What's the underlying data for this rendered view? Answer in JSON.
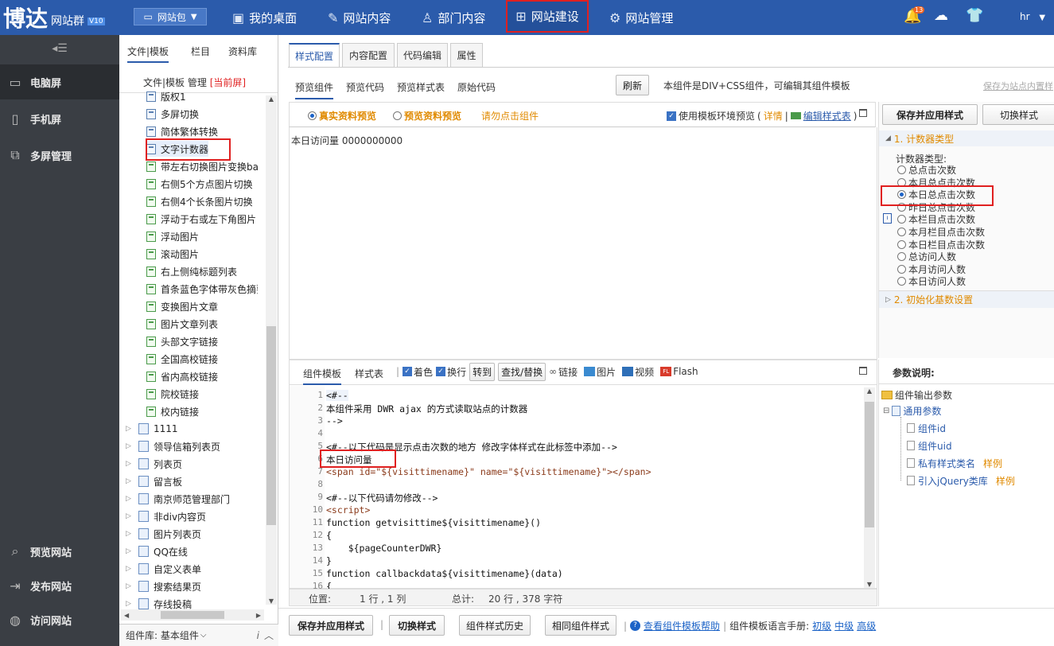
{
  "brand": {
    "name": "博达",
    "product": "网站群",
    "version": "V10",
    "accent": "#2b5bab"
  },
  "topbar": {
    "site_selector": "网站包",
    "nav": [
      {
        "label": "我的桌面",
        "icon": "monitor-icon"
      },
      {
        "label": "网站内容",
        "icon": "edit-icon"
      },
      {
        "label": "部门内容",
        "icon": "org-icon"
      },
      {
        "label": "网站建设",
        "icon": "build-icon",
        "active": true
      },
      {
        "label": "网站管理",
        "icon": "manage-icon"
      }
    ],
    "notif_count": "13",
    "user": "hr"
  },
  "leftnav": {
    "items": [
      {
        "label": "电脑屏",
        "icon": "desktop-icon"
      },
      {
        "label": "手机屏",
        "icon": "mobile-icon"
      },
      {
        "label": "多屏管理",
        "icon": "multiscreen-icon"
      }
    ],
    "bottom": [
      {
        "label": "预览网站",
        "icon": "preview-icon"
      },
      {
        "label": "发布网站",
        "icon": "publish-icon"
      },
      {
        "label": "访问网站",
        "icon": "globe-icon"
      }
    ]
  },
  "filepanel": {
    "tabs": [
      "文件|模板",
      "栏目",
      "资料库"
    ],
    "header": "文件|模板 管理",
    "header_tag": "[当前屏]",
    "items": [
      {
        "label": "版权1",
        "type": "doc"
      },
      {
        "label": "多屏切换",
        "type": "doc"
      },
      {
        "label": "简体繁体转换",
        "type": "doc"
      },
      {
        "label": "文字计数器",
        "type": "doc",
        "selected": true
      },
      {
        "label": "带左右切换图片变换bar",
        "type": "g"
      },
      {
        "label": "右侧5个方点图片切换",
        "type": "g"
      },
      {
        "label": "右侧4个长条图片切换",
        "type": "g"
      },
      {
        "label": "浮动于右或左下角图片",
        "type": "g"
      },
      {
        "label": "浮动图片",
        "type": "g"
      },
      {
        "label": "滚动图片",
        "type": "g"
      },
      {
        "label": "右上侧纯标题列表",
        "type": "g"
      },
      {
        "label": "首条蓝色字体带灰色摘要",
        "type": "g"
      },
      {
        "label": "变换图片文章",
        "type": "g"
      },
      {
        "label": "图片文章列表",
        "type": "g"
      },
      {
        "label": "头部文字链接",
        "type": "g"
      },
      {
        "label": "全国高校链接",
        "type": "g"
      },
      {
        "label": "省内高校链接",
        "type": "g"
      },
      {
        "label": "院校链接",
        "type": "g"
      },
      {
        "label": "校内链接",
        "type": "g"
      }
    ],
    "folders": [
      "1111",
      "领导信箱列表页",
      "列表页",
      "留言板",
      "南京师范管理部门",
      "非div内容页",
      "图片列表页",
      "QQ在线",
      "自定义表单",
      "搜索结果页",
      "存线投稿"
    ],
    "footer": "组件库: 基本组件"
  },
  "main": {
    "tabs": [
      "样式配置",
      "内容配置",
      "代码编辑",
      "属性"
    ],
    "subtabs": [
      "预览组件",
      "预览代码",
      "预览样式表",
      "原始代码"
    ],
    "refresh": "刷新",
    "desc": "本组件是DIV+CSS组件，可编辑其组件模板",
    "save_as": "保存为站点内置样",
    "preview_real": "真实资料预览",
    "preview_sample": "预览资料预览",
    "dont_click": "请勿点击组件",
    "use_env": "使用模板环境预览",
    "detail": "详情",
    "edit_style": "编辑样式表",
    "preview_text": "本日访问量 0000000000"
  },
  "right": {
    "save_apply": "保存并应用样式",
    "switch_style": "切换样式",
    "section1": "1. 计数器类型",
    "counter_label": "计数器类型:",
    "options": [
      "总点击次数",
      "本月总点击次数",
      "本日总点击次数",
      "昨日总点击次数",
      "本栏目点击次数",
      "本月栏目点击次数",
      "本日栏目点击次数",
      "总访问人数",
      "本月访问人数",
      "本日访问人数"
    ],
    "selected_index": 2,
    "section2": "2. 初始化基数设置",
    "param_title": "参数说明:",
    "params_root": "组件输出参数",
    "params_group": "通用参数",
    "params": [
      {
        "name": "组件id",
        "tag": ""
      },
      {
        "name": "组件uid",
        "tag": ""
      },
      {
        "name": "私有样式类名",
        "tag": "样例"
      },
      {
        "name": "引入jQuery类库",
        "tag": "样例"
      }
    ]
  },
  "editor": {
    "tabs": [
      "组件模板",
      "样式表"
    ],
    "toolbar": {
      "color": "着色",
      "wrap": "换行",
      "goto": "转到",
      "find": "查找/替换",
      "link": "链接",
      "image": "图片",
      "video": "视频",
      "flash": "Flash"
    },
    "lines": [
      "<#--",
      "本组件采用 DWR ajax 的方式读取站点的计数器",
      "-->",
      "",
      "<#--以下代码是显示点击次数的地方 修改字体样式在此标签中添加-->",
      "本日访问量",
      "<span id=\"${visittimename}\" name=\"${visittimename}\"></span>",
      "",
      "<#--以下代码请勿修改-->",
      "<script>",
      "function getvisittime${visittimename}()",
      "{",
      "    ${pageCounterDWR}",
      "}",
      "function callbackdata${visittimename}(data)",
      "{"
    ],
    "status_pos_label": "位置:",
    "status_pos": "1 行 , 1 列",
    "status_total_label": "总计:",
    "status_total": "20 行 , 378 字符"
  },
  "bottombar": {
    "save_apply": "保存并应用样式",
    "switch_style": "切换样式",
    "history": "组件样式历史",
    "same": "相同组件样式",
    "help": "查看组件模板帮助",
    "manual": "组件模板语言手册:",
    "levels": [
      "初级",
      "中级",
      "高级"
    ]
  }
}
